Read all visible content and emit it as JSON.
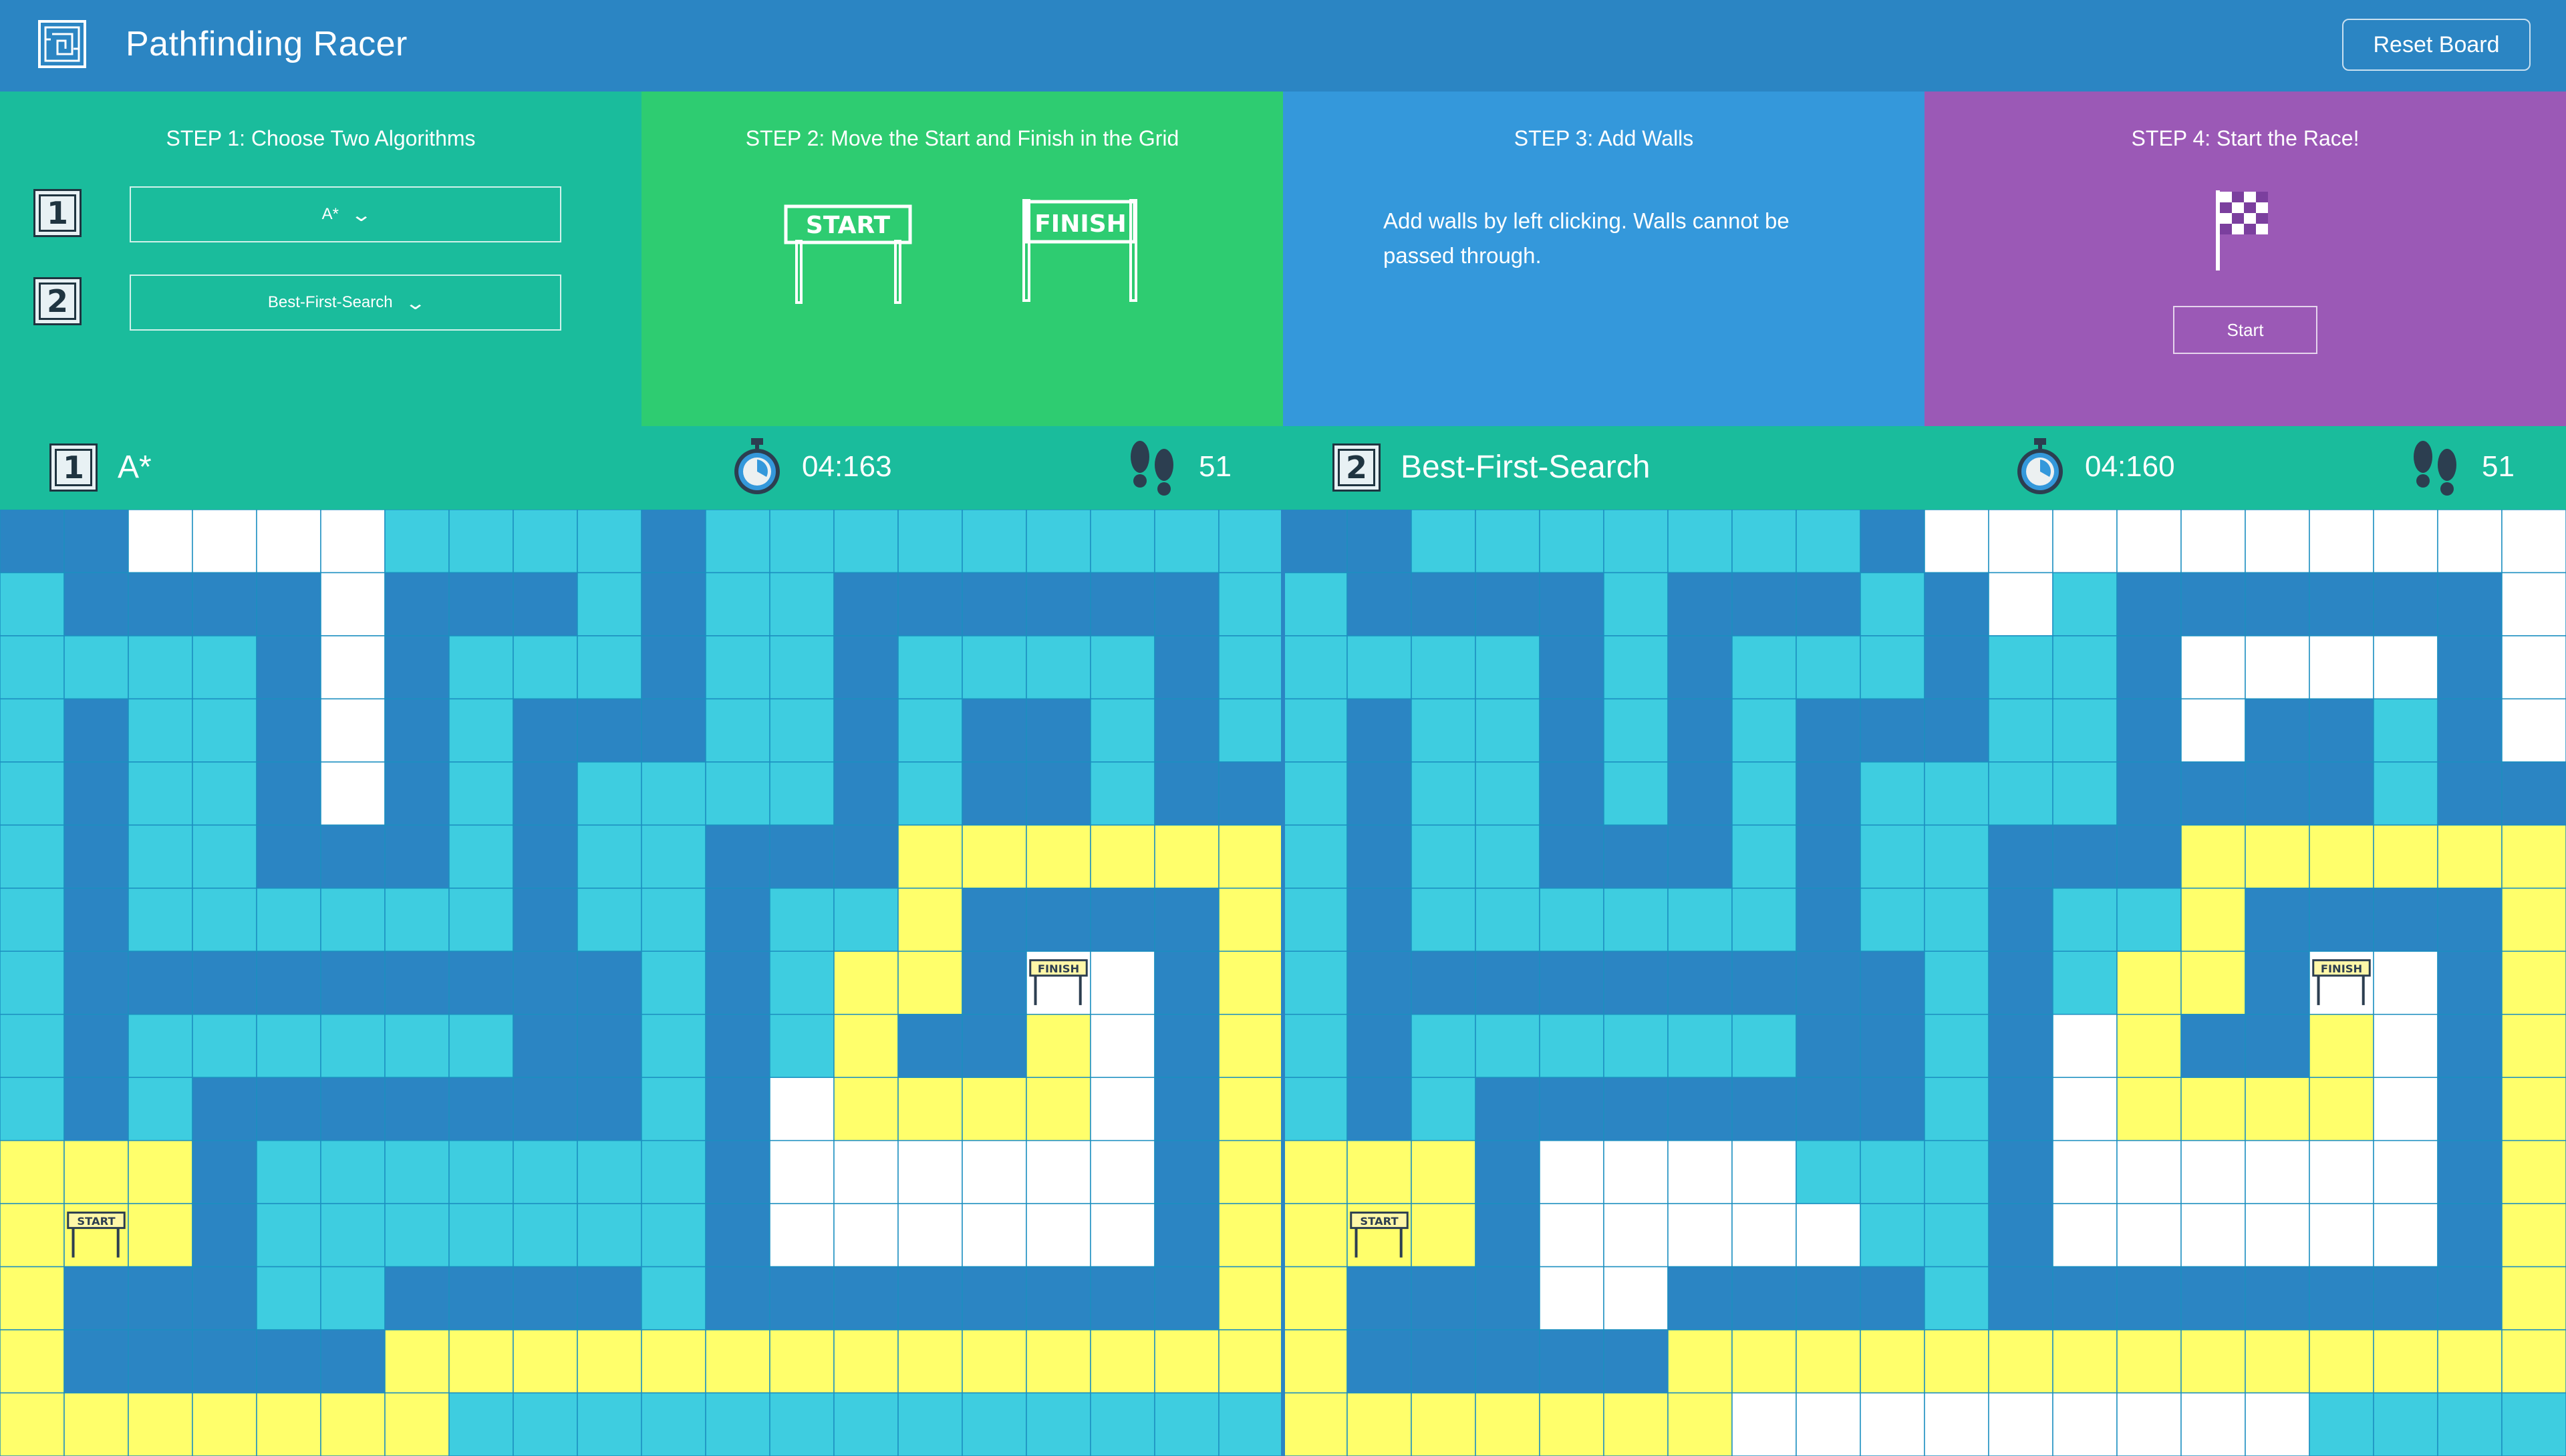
{
  "app": {
    "title": "Pathfinding Racer",
    "reset_label": "Reset Board"
  },
  "steps": {
    "step1": {
      "title": "STEP 1: Choose Two Algorithms",
      "badge1": "1",
      "badge2": "2",
      "algo1": "A*",
      "algo2": "Best-First-Search"
    },
    "step2": {
      "title": "STEP 2: Move the Start and Finish in the Grid",
      "start_sign": "START",
      "finish_sign": "FINISH"
    },
    "step3": {
      "title": "STEP 3: Add Walls",
      "description": "Add walls by left clicking. Walls cannot be passed through."
    },
    "step4": {
      "title": "STEP 4: Start the Race!",
      "start_label": "Start"
    }
  },
  "race": [
    {
      "badge": "1",
      "algorithm": "A*",
      "time": "04:163",
      "steps": "51"
    },
    {
      "badge": "2",
      "algorithm": "Best-First-Search",
      "time": "04:160",
      "steps": "51"
    }
  ],
  "colors": {
    "wall": "#2b85c3",
    "visited": "#3ecde0",
    "path": "#ffff6b",
    "empty": "#ffffff",
    "grid_line": "#1c8fc0",
    "step1": "#1abc9c",
    "step2": "#2ecc71",
    "step3": "#3498db",
    "step4": "#9b59b6"
  },
  "icons": {
    "logo": "maze-icon",
    "time": "stopwatch-icon",
    "steps": "footprints-icon",
    "step4": "checkered-flag-icon"
  },
  "grid_legend": {
    "W": "wall",
    "V": "visited",
    "Y": "path",
    "E": "empty",
    "S": "start",
    "F": "finish"
  },
  "grids": {
    "left": [
      "WWEEEEVVVVWVVVVVVVVV",
      "VWWWWEWWWVWVVWWWWWWV",
      "VVVVWEWVVVWVVWVVVVWV",
      "VWVVWEWVWWWVVWVWWVWV",
      "VWVVWEWVWVVVVWVWWVWW",
      "VWVVWWWVWVVWWWYYYYYY",
      "VWVVVVVVWVVWVVYWWWWY",
      "VWWWWWWWWWVWVYYWFEWY",
      "VWVVVVVVWWVWVYWWYEWY",
      "VWVWWWWWWWVWEYYYYEWY",
      "YYYWVVVVVVVWEEEEEEWY",
      "YSYWVVVVVVVWEEEEEEWY",
      "YWWWVVWWWWVWWWWWWWWY",
      "YWWWWWYYYYYYYYYYYYYY",
      "YYYYYYYVVVVVVVVVVVVV"
    ],
    "right": [
      "WWVVVVVVVWEEEEEEEEEE",
      "VWWWWVWWWVWEVWWWWWWE",
      "VVVVWVWVVVWVVWEEEEWE",
      "VWVVWVWVWWWVVWEWWVWE",
      "VWVVWVWVWVVVVWWWWVWW",
      "VWVVWWWVWVVWWWYYYYYY",
      "VWVVVVVVWVVWVVYWWWWY",
      "VWWWWWWWWWVWVYYWFEWY",
      "VWVVVVVVWWVWEYWWYEWY",
      "VWVWWWWWWWVWEYYYYEWY",
      "YYYWEEEEVVVWEEEEEEWY",
      "YSYWEEEEEVVWEEEEEEWY",
      "YWWWEEWWWWVWWWWWWWWY",
      "YWWWWWYYYYYYYYYYYYYY",
      "YYYYYYYEEEEEEEEEVVVV"
    ]
  }
}
